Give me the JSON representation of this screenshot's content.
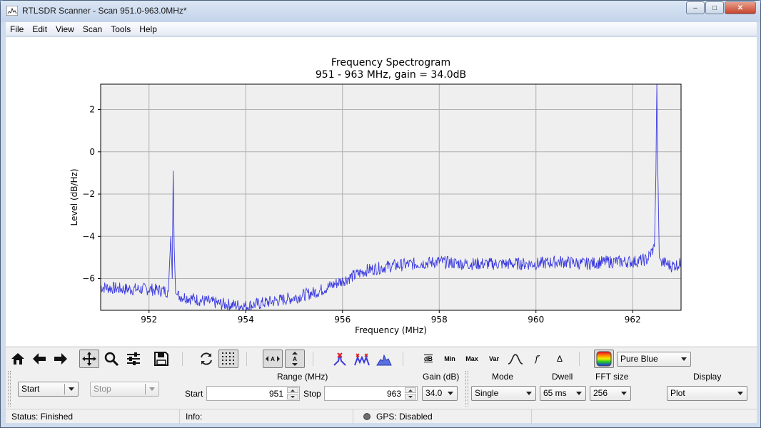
{
  "window": {
    "title": "RTLSDR Scanner - Scan 951.0-963.0MHz*",
    "minimize": "–",
    "maximize": "□",
    "close": "✕"
  },
  "menu": [
    "File",
    "Edit",
    "View",
    "Scan",
    "Tools",
    "Help"
  ],
  "chart_data": {
    "type": "line",
    "title": "Frequency Spectrogram",
    "subtitle": "951 - 963 MHz, gain = 34.0dB",
    "xlabel": "Frequency (MHz)",
    "ylabel": "Level (dB/Hz)",
    "xlim": [
      951.0,
      963.0
    ],
    "ylim": [
      -7.5,
      3.2
    ],
    "xticks": [
      952,
      954,
      956,
      958,
      960,
      962
    ],
    "yticks": [
      -6,
      -4,
      -2,
      0,
      2
    ],
    "ytick_labels": [
      "−6",
      "−4",
      "−2",
      "0",
      "2"
    ],
    "grid": true,
    "line_color": "#3a3ae0",
    "series": [
      {
        "x": [
          951.0,
          951.5,
          952.0,
          952.4,
          952.45,
          952.48,
          952.5,
          952.52,
          952.55,
          952.6,
          953.0,
          953.5,
          954.0,
          954.5,
          955.0,
          955.5,
          956.0,
          956.5,
          957.0,
          957.5,
          958.0,
          958.5,
          959.0,
          959.5,
          960.0,
          960.5,
          961.0,
          961.5,
          962.0,
          962.3,
          962.45,
          962.48,
          962.5,
          962.52,
          962.55,
          962.6,
          962.8,
          963.0
        ],
        "y": [
          -6.4,
          -6.5,
          -6.5,
          -6.6,
          -4.0,
          -6.0,
          -0.9,
          -4.5,
          -6.7,
          -6.8,
          -7.0,
          -7.2,
          -7.3,
          -7.1,
          -6.9,
          -6.6,
          -6.1,
          -5.6,
          -5.4,
          -5.3,
          -5.2,
          -5.3,
          -5.3,
          -5.3,
          -5.3,
          -5.2,
          -5.3,
          -5.2,
          -5.2,
          -5.1,
          -4.5,
          -1.0,
          3.2,
          -0.9,
          -5.0,
          -5.2,
          -5.4,
          -5.3
        ]
      }
    ]
  },
  "toolbar": {
    "db_label": "dB",
    "min_label": "Min",
    "max_label": "Max",
    "var_label": "Var",
    "curve_label": "∩",
    "deriv_label": "f′",
    "delta_label": "Δ",
    "colormap": "Pure Blue"
  },
  "controls": {
    "start_button": "Start",
    "stop_button": "Stop",
    "range_label": "Range (MHz)",
    "start_label": "Start",
    "start_value": "951",
    "stop_label": "Stop",
    "stop_value": "963",
    "gain_label": "Gain (dB)",
    "gain_value": "34.0",
    "mode_label": "Mode",
    "mode_value": "Single",
    "dwell_label": "Dwell",
    "dwell_value": "65 ms",
    "fft_label": "FFT size",
    "fft_value": "256",
    "display_label": "Display",
    "display_value": "Plot"
  },
  "status": {
    "status_text": "Status: Finished",
    "info_text": "Info:",
    "gps_text": "GPS: Disabled"
  }
}
